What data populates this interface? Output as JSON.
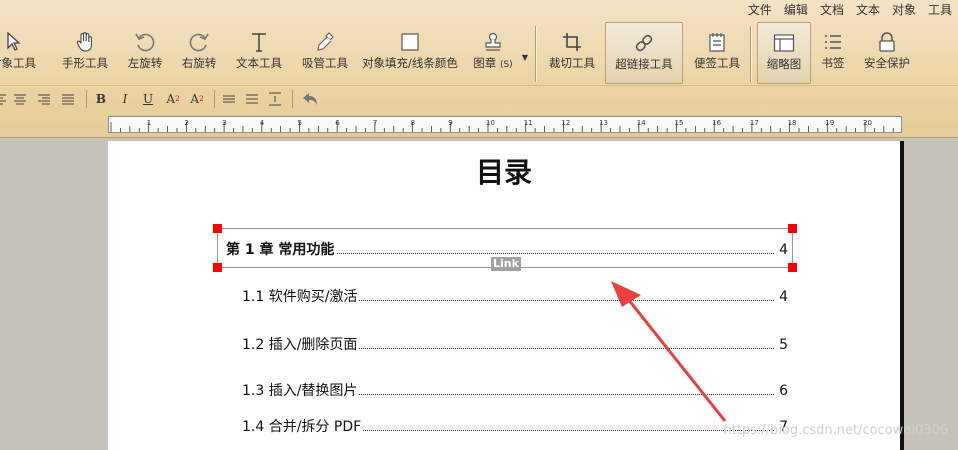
{
  "menu": [
    "文件",
    "编辑",
    "文档",
    "文本",
    "对象",
    "工具"
  ],
  "tools": {
    "object_tool": "对象工具",
    "hand_tool": "手形工具",
    "rotate_left": "左旋转",
    "rotate_right": "右旋转",
    "text_tool": "文本工具",
    "eyedropper_tool": "吸管工具",
    "fill_stroke_color": "对象填充/线条颜色",
    "stamp": "图章",
    "stamp_shortcut": "(S)",
    "crop_tool": "裁切工具",
    "hyperlink_tool": "超链接工具",
    "sticky_note_tool": "便签工具",
    "thumbnails": "缩略图",
    "bookmarks": "书签",
    "security": "安全保护"
  },
  "format": {
    "bold": "B",
    "italic": "I",
    "underline": "U",
    "superscript": "A",
    "superscript_mark": "2",
    "subscript": "A",
    "subscript_mark": "2"
  },
  "ruler_labels": [
    "1",
    "2",
    "3",
    "4",
    "5",
    "6",
    "7",
    "8",
    "9",
    "10",
    "11",
    "12",
    "13",
    "14",
    "15",
    "16",
    "17",
    "18",
    "19",
    "20"
  ],
  "document": {
    "title": "目录",
    "link_label": "Link",
    "entries": [
      {
        "text": "第 1 章  常用功能",
        "page": "4"
      },
      {
        "text": "1.1 软件购买/激活",
        "page": "4"
      },
      {
        "text": "1.2 插入/删除页面",
        "page": "5"
      },
      {
        "text": "1.3 插入/替换图片",
        "page": "6"
      },
      {
        "text": "1.4 合并/拆分 PDF",
        "page": "7"
      }
    ]
  },
  "watermark": "https://blog.csdn.net/cocowei0306",
  "colors": {
    "handle": "#ff0000",
    "arrow": "#e84040",
    "toolbar": "#ecd4a6"
  }
}
